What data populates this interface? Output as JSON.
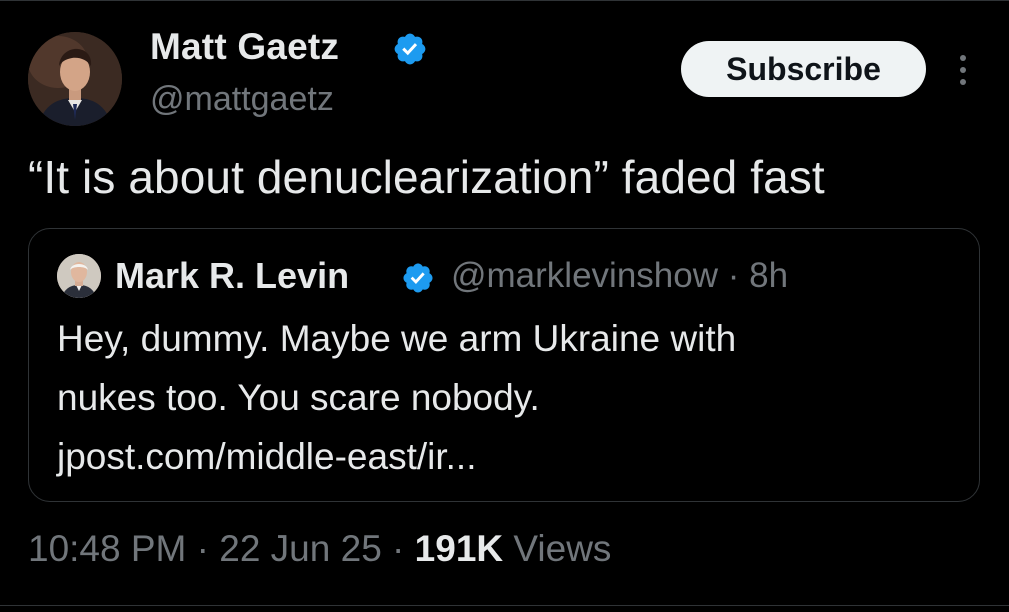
{
  "author": {
    "display_name": "Matt Gaetz",
    "handle": "@mattgaetz",
    "verified_icon": "verified-badge-icon"
  },
  "header": {
    "subscribe_label": "Subscribe",
    "more_icon": "more-vertical-icon"
  },
  "tweet": {
    "text": "“It is about denuclearization” faded fast"
  },
  "quoted_tweet": {
    "display_name": "Mark R. Levin",
    "handle_time": "@marklevinshow · 8h",
    "lines": [
      "Hey, dummy. Maybe we arm Ukraine with",
      "nukes too. You scare nobody.",
      "jpost.com/middle-east/ir..."
    ]
  },
  "meta": {
    "timestamp": "10:48 PM · 22 Jun 25 · ",
    "views_count": "191K",
    "views_label": " Views"
  },
  "colors": {
    "background": "#000000",
    "text_primary": "#e7e9ea",
    "text_secondary": "#71767b",
    "verified_blue": "#1d9bf0",
    "border": "#2f3336"
  }
}
